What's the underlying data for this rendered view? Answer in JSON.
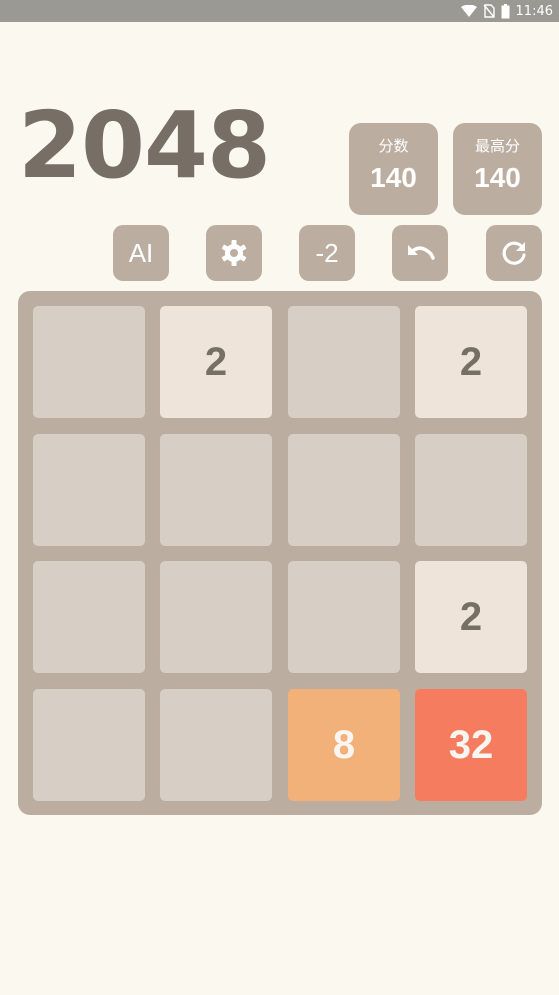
{
  "status_bar": {
    "time": "11:46",
    "icons": [
      "wifi-icon",
      "no-sim-icon",
      "battery-icon"
    ]
  },
  "game": {
    "title": "2048",
    "score_label": "分数",
    "score_value": "140",
    "best_label": "最高分",
    "best_value": "140"
  },
  "toolbar": {
    "ai_label": "AI",
    "settings_icon": "gear-icon",
    "minus_label": "-2",
    "undo_icon": "undo-icon",
    "restart_icon": "restart-icon"
  },
  "board": {
    "rows": [
      [
        "",
        "2",
        "",
        "2"
      ],
      [
        "",
        "",
        "",
        ""
      ],
      [
        "",
        "",
        "",
        "2"
      ],
      [
        "",
        "",
        "8",
        "32"
      ]
    ]
  },
  "colors": {
    "background": "#fbf8f0",
    "board": "#bbada0",
    "empty_cell": "#d7cfc6",
    "tile_2": "#eee4da",
    "tile_8": "#f2b179",
    "tile_32": "#f67c5f",
    "dark_text": "#776e65"
  }
}
